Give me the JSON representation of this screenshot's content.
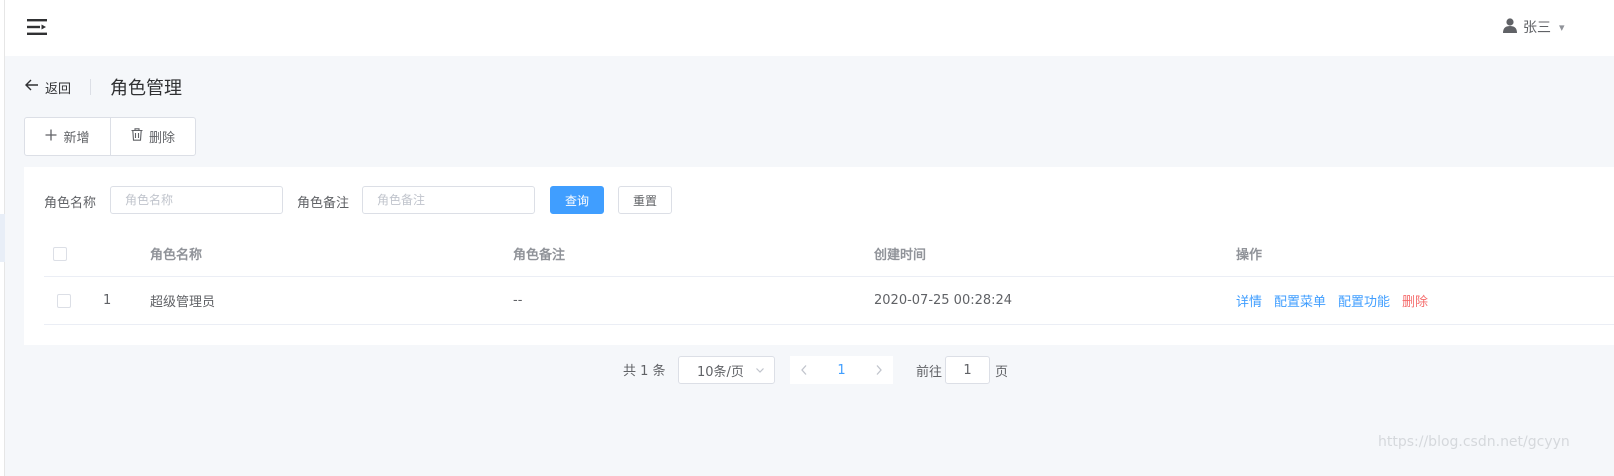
{
  "header": {
    "menu_icon": "menu-fold-icon",
    "user_icon": "user-icon",
    "user_name": "张三"
  },
  "page": {
    "back_label": "返回",
    "title": "角色管理"
  },
  "toolbar": {
    "add_label": "新增",
    "delete_label": "删除"
  },
  "search": {
    "name_label": "角色名称",
    "name_placeholder": "角色名称",
    "remark_label": "角色备注",
    "remark_placeholder": "角色备注",
    "query_label": "查询",
    "reset_label": "重置"
  },
  "table": {
    "columns": [
      "角色名称",
      "角色备注",
      "创建时间",
      "操作"
    ],
    "rows": [
      {
        "index": "1",
        "name": "超级管理员",
        "remark": "--",
        "created_at": "2020-07-25 00:28:24",
        "actions": [
          "详情",
          "配置菜单",
          "配置功能",
          "删除"
        ]
      }
    ]
  },
  "pagination": {
    "total_text": "共 1 条",
    "page_size": "10条/页",
    "current_page": "1",
    "goto_prefix": "前往",
    "goto_value": "1",
    "goto_suffix": "页"
  },
  "watermark": "https://blog.csdn.net/gcyyn",
  "colors": {
    "primary": "#409eff",
    "danger": "#f56c6c",
    "background": "#f5f7fa"
  }
}
